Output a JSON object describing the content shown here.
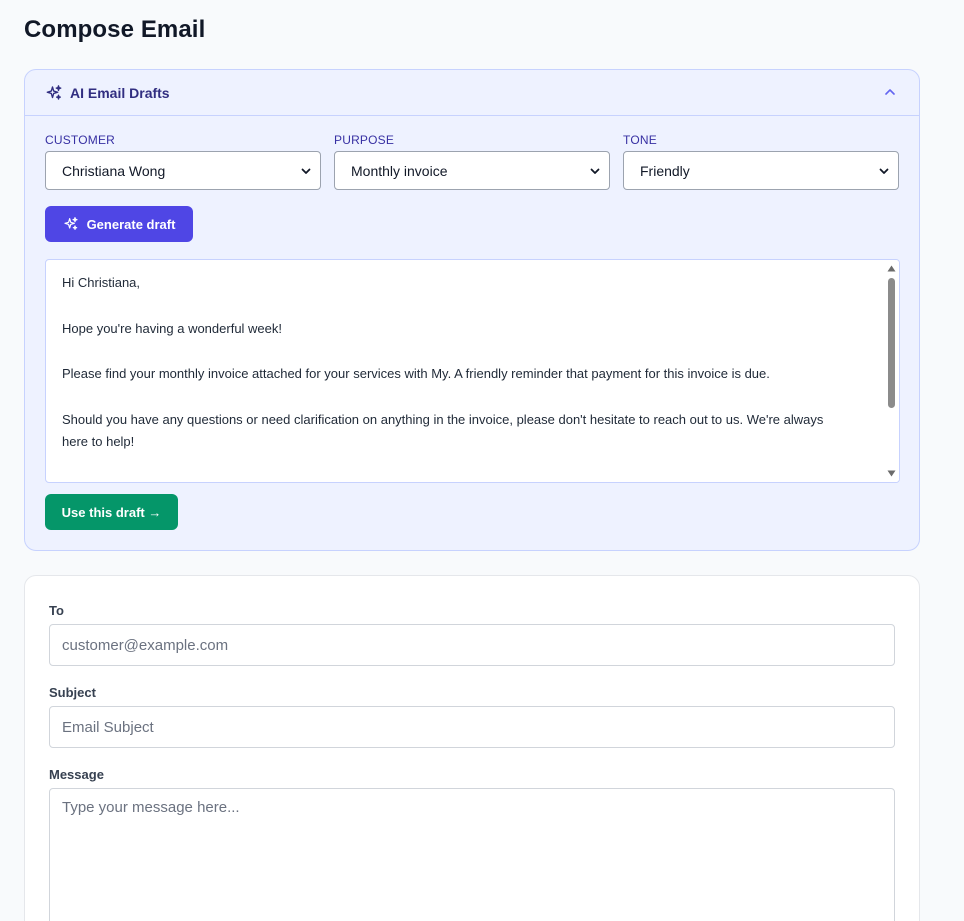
{
  "page": {
    "title": "Compose Email"
  },
  "ai_panel": {
    "title": "AI Email Drafts",
    "icon": "sparkles-icon",
    "collapse_icon": "chevron-up-icon",
    "accent_color": "#4f46e5",
    "fields": {
      "customer": {
        "label": "CUSTOMER",
        "value": "Christiana Wong"
      },
      "purpose": {
        "label": "PURPOSE",
        "value": "Monthly invoice"
      },
      "tone": {
        "label": "TONE",
        "value": "Friendly"
      }
    },
    "generate_button": "Generate draft",
    "draft": {
      "greeting": "Hi Christiana,",
      "p1": "Hope you're having a wonderful week!",
      "p2": "Please find your monthly invoice attached for your services with My. A friendly reminder that payment for this invoice is due.",
      "p3": "Should you have any questions or need clarification on anything in the invoice, please don't hesitate to reach out to us. We're always here to help!"
    },
    "use_button": "Use this draft →",
    "use_button_color": "#059669"
  },
  "compose": {
    "to": {
      "label": "To",
      "placeholder": "customer@example.com"
    },
    "subject": {
      "label": "Subject",
      "placeholder": "Email Subject"
    },
    "message": {
      "label": "Message",
      "placeholder": "Type your message here..."
    }
  }
}
